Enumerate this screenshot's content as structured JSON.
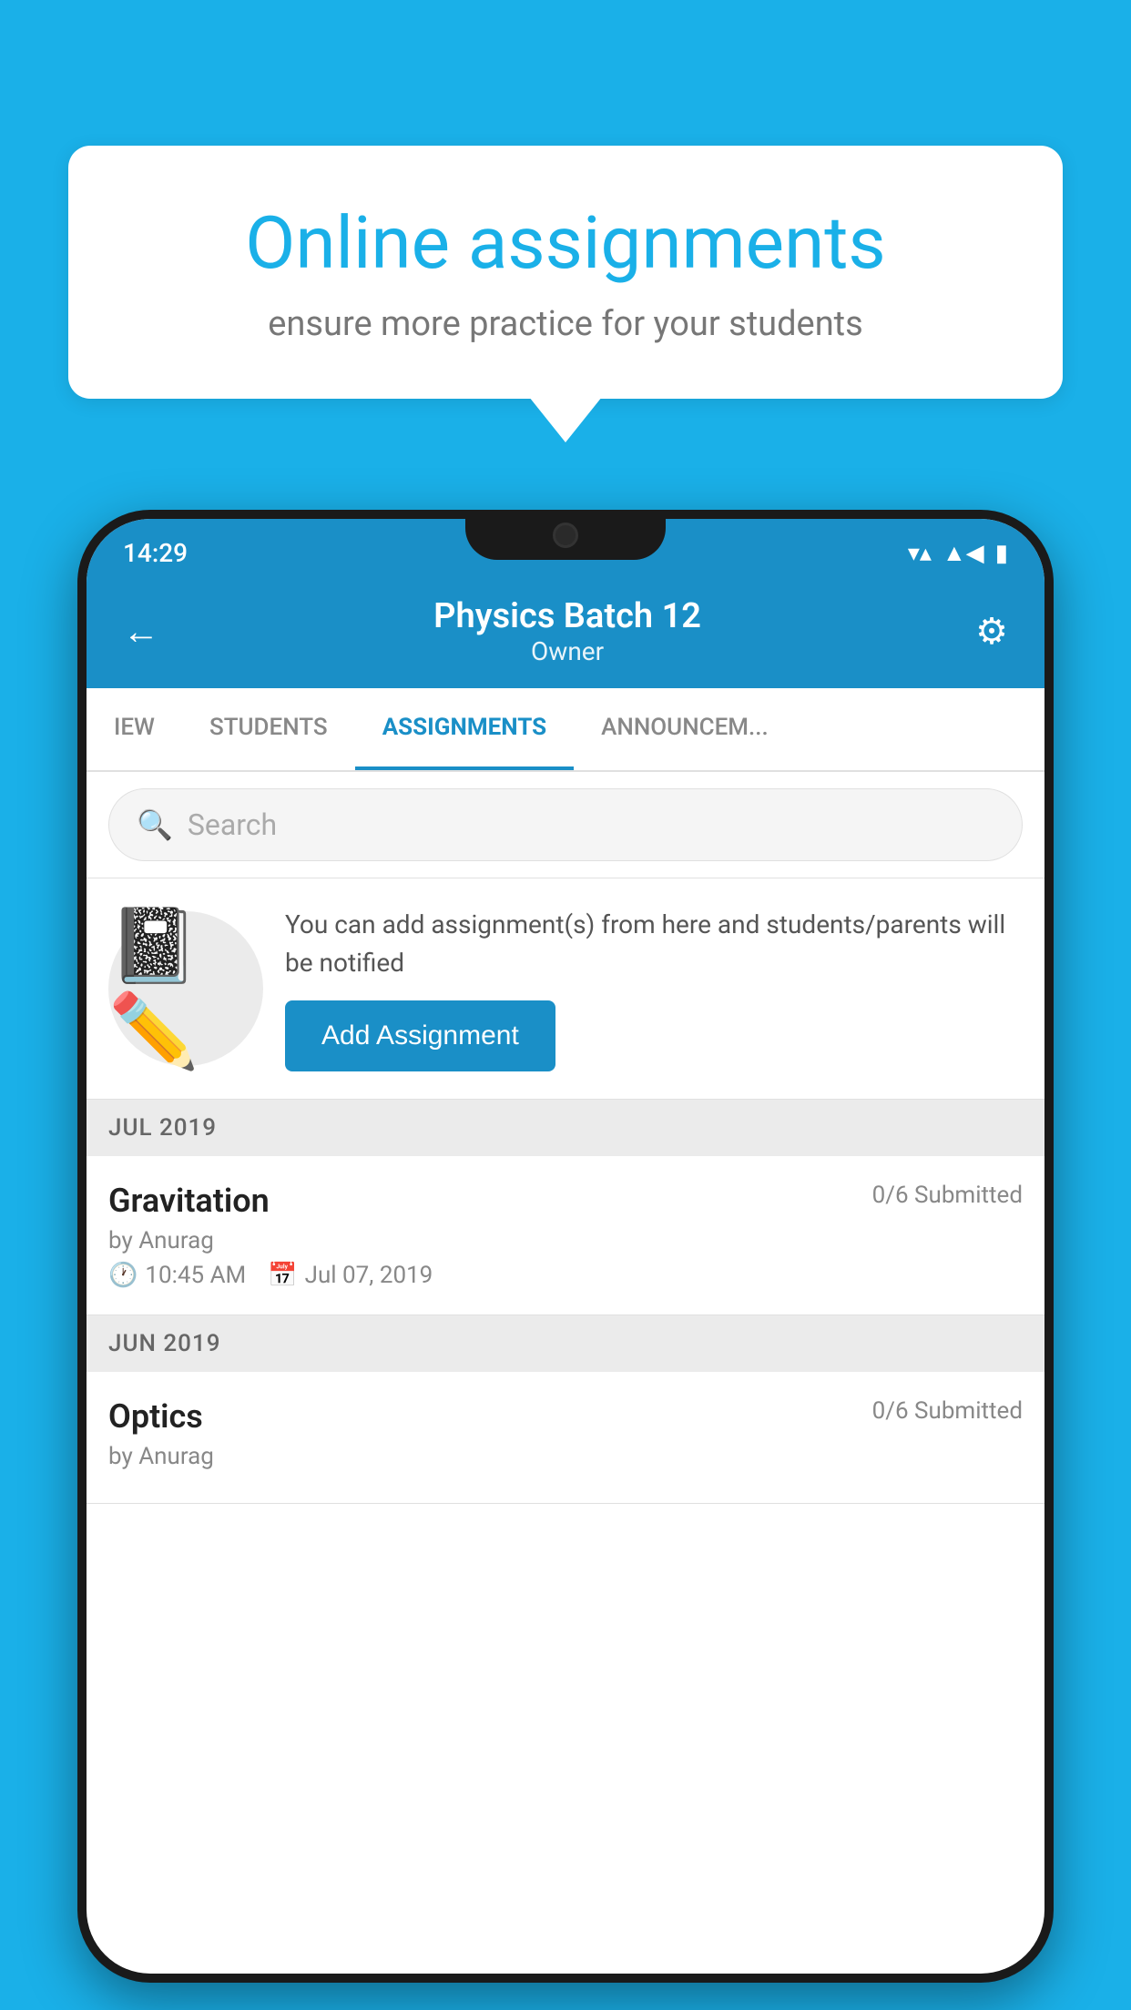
{
  "background_color": "#1ab0e8",
  "speech_bubble": {
    "title": "Online assignments",
    "subtitle": "ensure more practice for your students"
  },
  "status_bar": {
    "time": "14:29",
    "icons": [
      "wifi",
      "signal",
      "battery"
    ]
  },
  "header": {
    "title": "Physics Batch 12",
    "subtitle": "Owner",
    "back_label": "←",
    "settings_label": "⚙"
  },
  "tabs": [
    {
      "label": "IEW",
      "active": false
    },
    {
      "label": "STUDENTS",
      "active": false
    },
    {
      "label": "ASSIGNMENTS",
      "active": true
    },
    {
      "label": "ANNOUNCEM...",
      "active": false
    }
  ],
  "search": {
    "placeholder": "Search"
  },
  "promo": {
    "text": "You can add assignment(s) from here and students/parents will be notified",
    "button_label": "Add Assignment"
  },
  "sections": [
    {
      "month": "JUL 2019",
      "assignments": [
        {
          "name": "Gravitation",
          "submitted": "0/6 Submitted",
          "author": "by Anurag",
          "time": "10:45 AM",
          "date": "Jul 07, 2019"
        }
      ]
    },
    {
      "month": "JUN 2019",
      "assignments": [
        {
          "name": "Optics",
          "submitted": "0/6 Submitted",
          "author": "by Anurag",
          "time": "",
          "date": ""
        }
      ]
    }
  ]
}
